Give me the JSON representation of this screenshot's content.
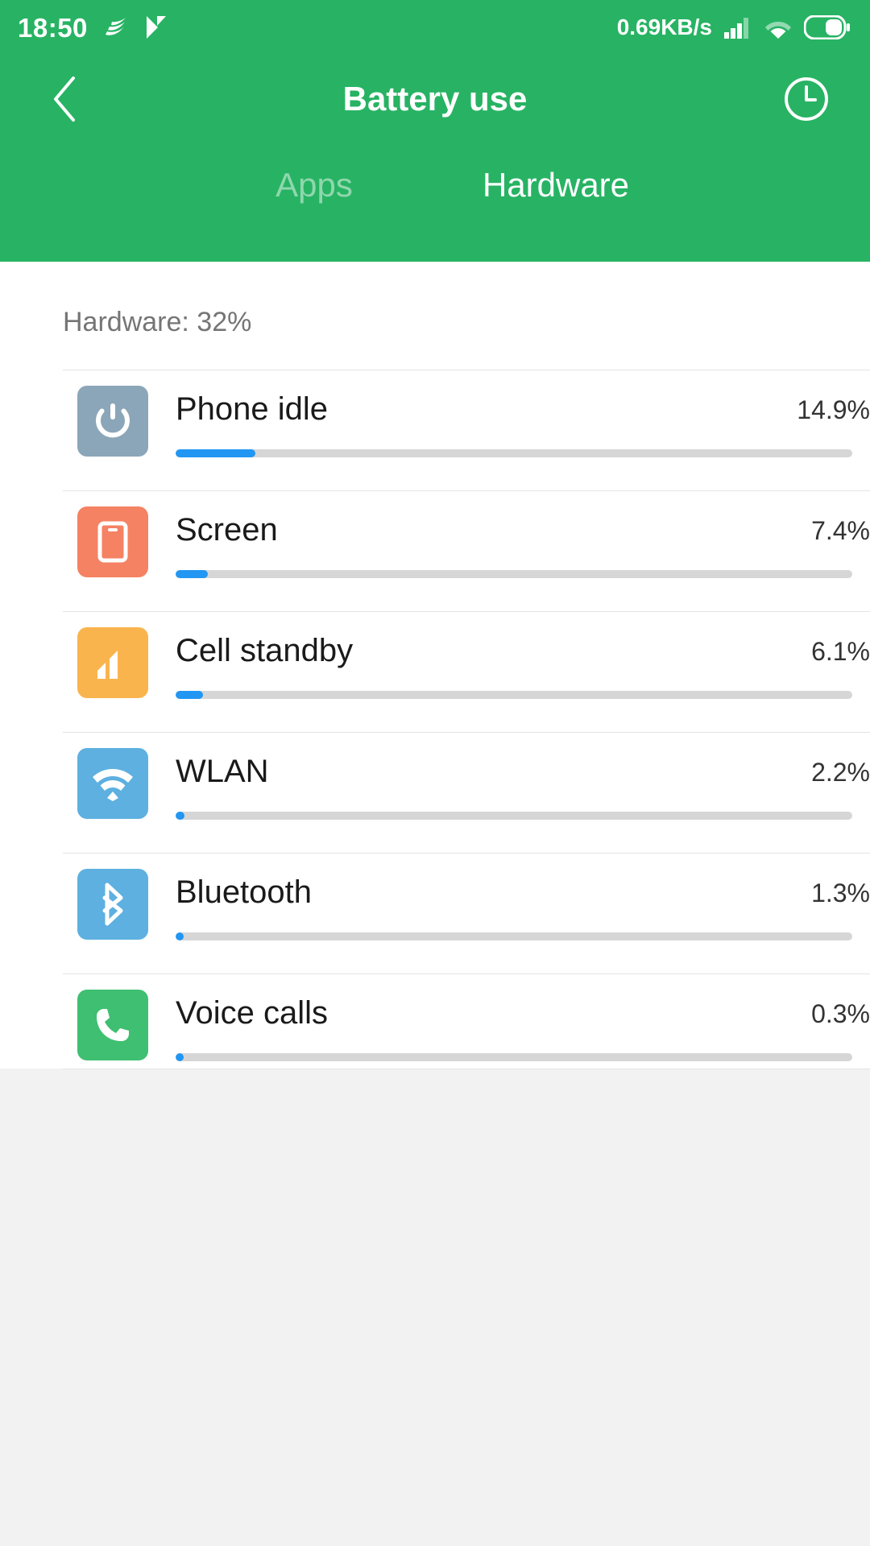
{
  "theme": {
    "header_green": "#27b363",
    "progress_blue": "#2196f3",
    "track_gray": "#d6d6d6",
    "label_gray": "#757575"
  },
  "status_bar": {
    "time": "18:50",
    "network_speed": "0.69KB/s",
    "icons": [
      "swiftkey-icon",
      "player-icon",
      "signal-icon",
      "wifi-icon",
      "battery-icon"
    ]
  },
  "header": {
    "title": "Battery use",
    "back_icon": "chevron-left-icon",
    "history_icon": "clock-icon"
  },
  "tabs": [
    {
      "label": "Apps",
      "active": false
    },
    {
      "label": "Hardware",
      "active": true
    }
  ],
  "main": {
    "section_label": "Hardware: 32%",
    "rows": [
      {
        "name": "Phone idle",
        "percent": "14.9%",
        "value": 14.9,
        "bar_fraction": 0.118,
        "icon": "power-icon",
        "icon_color": "#8ba6b8"
      },
      {
        "name": "Screen",
        "percent": "7.4%",
        "value": 7.4,
        "bar_fraction": 0.048,
        "icon": "phone-screen-icon",
        "icon_color": "#f58263"
      },
      {
        "name": "Cell standby",
        "percent": "6.1%",
        "value": 6.1,
        "bar_fraction": 0.041,
        "icon": "signal-bars-icon",
        "icon_color": "#fab44e"
      },
      {
        "name": "WLAN",
        "percent": "2.2%",
        "value": 2.2,
        "bar_fraction": 0.013,
        "icon": "wifi-icon",
        "icon_color": "#5db0e0"
      },
      {
        "name": "Bluetooth",
        "percent": "1.3%",
        "value": 1.3,
        "bar_fraction": 0.009,
        "icon": "bluetooth-icon",
        "icon_color": "#5db0e0"
      },
      {
        "name": "Voice calls",
        "percent": "0.3%",
        "value": 0.3,
        "bar_fraction": 0.004,
        "icon": "phone-call-icon",
        "icon_color": "#3fbf71"
      }
    ]
  }
}
